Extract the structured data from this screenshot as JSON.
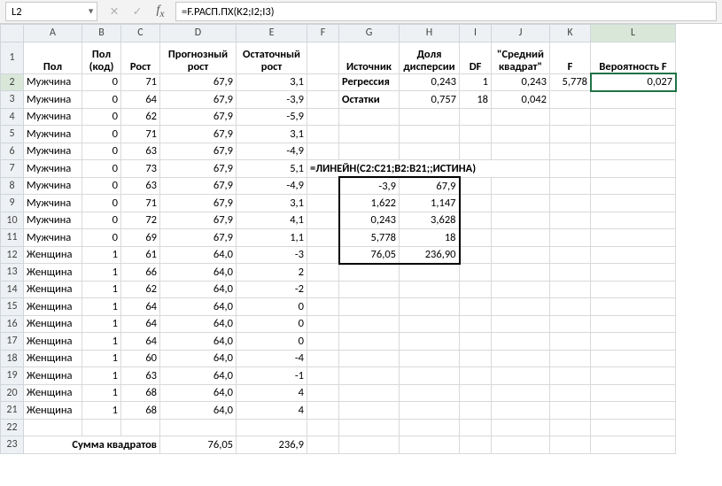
{
  "namebox": "L2",
  "formula": "=F.РАСП.ПХ(K2;I2;I3)",
  "col_letters": [
    "A",
    "B",
    "C",
    "D",
    "E",
    "F",
    "G",
    "H",
    "I",
    "J",
    "K",
    "L"
  ],
  "row_numbers": [
    1,
    2,
    3,
    4,
    5,
    6,
    7,
    8,
    9,
    10,
    11,
    12,
    13,
    14,
    15,
    16,
    17,
    18,
    19,
    20,
    21,
    22,
    23
  ],
  "headers": {
    "A": "Пол",
    "B": "Пол (код)",
    "C": "Рост",
    "D": "Прогнозный рост",
    "E": "Остаточный рост",
    "G": "Источник",
    "H": "Доля дисперсии",
    "I": "DF",
    "J": "\"Средний квадрат\"",
    "K": "F",
    "L": "Вероятность F"
  },
  "rows": [
    {
      "A": "Мужчина",
      "B": "0",
      "C": "71",
      "D": "67,9",
      "E": "3,1",
      "G": "Регрессия",
      "H": "0,243",
      "I": "1",
      "J": "0,243",
      "K": "5,778",
      "L": "0,027"
    },
    {
      "A": "Мужчина",
      "B": "0",
      "C": "64",
      "D": "67,9",
      "E": "-3,9",
      "G": "Остатки",
      "H": "0,757",
      "I": "18",
      "J": "0,042"
    },
    {
      "A": "Мужчина",
      "B": "0",
      "C": "62",
      "D": "67,9",
      "E": "-5,9"
    },
    {
      "A": "Мужчина",
      "B": "0",
      "C": "71",
      "D": "67,9",
      "E": "3,1"
    },
    {
      "A": "Мужчина",
      "B": "0",
      "C": "63",
      "D": "67,9",
      "E": "-4,9"
    },
    {
      "A": "Мужчина",
      "B": "0",
      "C": "73",
      "D": "67,9",
      "E": "5,1",
      "F7": "=ЛИНЕЙН(C2:C21;B2:B21;;ИСТИНА)"
    },
    {
      "A": "Мужчина",
      "B": "0",
      "C": "63",
      "D": "67,9",
      "E": "-4,9",
      "G": "-3,9",
      "H": "67,9"
    },
    {
      "A": "Мужчина",
      "B": "0",
      "C": "71",
      "D": "67,9",
      "E": "3,1",
      "G": "1,622",
      "H": "1,147"
    },
    {
      "A": "Мужчина",
      "B": "0",
      "C": "72",
      "D": "67,9",
      "E": "4,1",
      "G": "0,243",
      "H": "3,628"
    },
    {
      "A": "Мужчина",
      "B": "0",
      "C": "69",
      "D": "67,9",
      "E": "1,1",
      "G": "5,778",
      "H": "18"
    },
    {
      "A": "Женщина",
      "B": "1",
      "C": "61",
      "D": "64,0",
      "E": "-3",
      "G": "76,05",
      "H": "236,90"
    },
    {
      "A": "Женщина",
      "B": "1",
      "C": "66",
      "D": "64,0",
      "E": "2"
    },
    {
      "A": "Женщина",
      "B": "1",
      "C": "62",
      "D": "64,0",
      "E": "-2"
    },
    {
      "A": "Женщина",
      "B": "1",
      "C": "64",
      "D": "64,0",
      "E": "0"
    },
    {
      "A": "Женщина",
      "B": "1",
      "C": "64",
      "D": "64,0",
      "E": "0"
    },
    {
      "A": "Женщина",
      "B": "1",
      "C": "64",
      "D": "64,0",
      "E": "0"
    },
    {
      "A": "Женщина",
      "B": "1",
      "C": "60",
      "D": "64,0",
      "E": "-4"
    },
    {
      "A": "Женщина",
      "B": "1",
      "C": "63",
      "D": "64,0",
      "E": "-1"
    },
    {
      "A": "Женщина",
      "B": "1",
      "C": "68",
      "D": "64,0",
      "E": "4"
    },
    {
      "A": "Женщина",
      "B": "1",
      "C": "68",
      "D": "64,0",
      "E": "4"
    }
  ],
  "sumsq": {
    "label": "Сумма квадратов",
    "D": "76,05",
    "E": "236,9"
  },
  "active_cell": "L2"
}
